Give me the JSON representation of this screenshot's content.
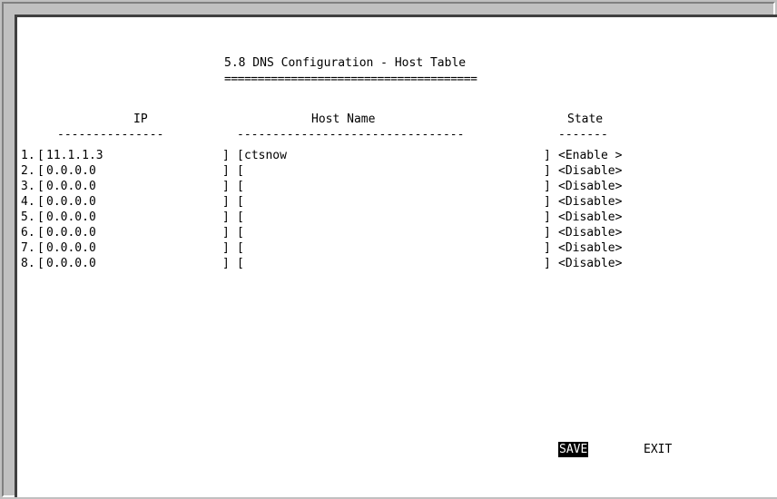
{
  "screen": {
    "title": "5.8 DNS Configuration - Host Table",
    "title_rule": "======================================"
  },
  "table": {
    "headers": {
      "ip": "IP",
      "host": "Host Name",
      "state": "State"
    },
    "rules": {
      "ip": "---------------",
      "host": "--------------------------------",
      "state": "-------"
    },
    "rows": [
      {
        "index": "1.",
        "ip": "11.1.1.3",
        "host": "ctsnow",
        "state": "<Enable >"
      },
      {
        "index": "2.",
        "ip": "0.0.0.0",
        "host": "",
        "state": "<Disable>"
      },
      {
        "index": "3.",
        "ip": "0.0.0.0",
        "host": "",
        "state": "<Disable>"
      },
      {
        "index": "4.",
        "ip": "0.0.0.0",
        "host": "",
        "state": "<Disable>"
      },
      {
        "index": "5.",
        "ip": "0.0.0.0",
        "host": "",
        "state": "<Disable>"
      },
      {
        "index": "6.",
        "ip": "0.0.0.0",
        "host": "",
        "state": "<Disable>"
      },
      {
        "index": "7.",
        "ip": "0.0.0.0",
        "host": "",
        "state": "<Disable>"
      },
      {
        "index": "8.",
        "ip": "0.0.0.0",
        "host": "",
        "state": "<Disable>"
      }
    ]
  },
  "actions": {
    "save_label": "SAVE",
    "exit_label": "EXIT"
  }
}
